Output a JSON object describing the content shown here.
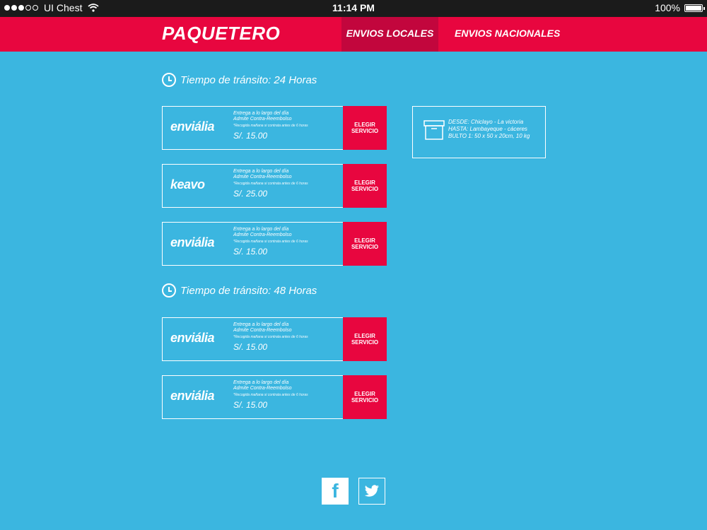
{
  "status": {
    "carrier": "UI Chest",
    "time": "11:14 PM",
    "battery": "100%"
  },
  "header": {
    "brand": "PAQUETERO",
    "tabs": [
      {
        "label": "ENVIOS LOCALES"
      },
      {
        "label": "ENVIOS NACIONALES"
      }
    ]
  },
  "sections": [
    {
      "title": "Tiempo de tránsito: 24 Horas"
    },
    {
      "title": "Tiempo de tránsito: 48 Horas"
    }
  ],
  "offers": [
    {
      "brand": "enviália",
      "line1": "Entrega a lo largo del día",
      "line2": "Admite Contra-Reembolso",
      "note": "*Recogida mañana si contrata antes de 6 horas",
      "price": "S/. 15.00",
      "cta": "ELEGIR SERVICIO"
    },
    {
      "brand": "keavo",
      "line1": "Entrega a lo largo del día",
      "line2": "Admite Contra-Reembolso",
      "note": "*Recogida mañana si contrata antes de 6 horas",
      "price": "S/. 25.00",
      "cta": "ELEGIR SERVICIO"
    },
    {
      "brand": "enviália",
      "line1": "Entrega a lo largo del día",
      "line2": "Admite Contra-Reembolso",
      "note": "*Recogida mañana si contrata antes de 6 horas",
      "price": "S/. 15.00",
      "cta": "ELEGIR SERVICIO"
    },
    {
      "brand": "enviália",
      "line1": "Entrega a lo largo del día",
      "line2": "Admite Contra-Reembolso",
      "note": "*Recogida mañana si contrata antes de 6 horas",
      "price": "S/. 15.00",
      "cta": "ELEGIR SERVICIO"
    },
    {
      "brand": "enviália",
      "line1": "Entrega a lo largo del día",
      "line2": "Admite Contra-Reembolso",
      "note": "*Recogida mañana si contrata antes de 6 horas",
      "price": "S/. 15.00",
      "cta": "ELEGIR SERVICIO"
    }
  ],
  "summary": {
    "from": "DESDE: Chiclayo - La victoria",
    "to": "HASTA: Lambayeque - cáceres",
    "package": "BULTO 1: 50 x 50 x 20cm, 10 kg"
  },
  "social": {
    "facebook": "f"
  },
  "colors": {
    "accent": "#e8063f",
    "accent_dark": "#c2063d",
    "background": "#3bb6e0"
  }
}
